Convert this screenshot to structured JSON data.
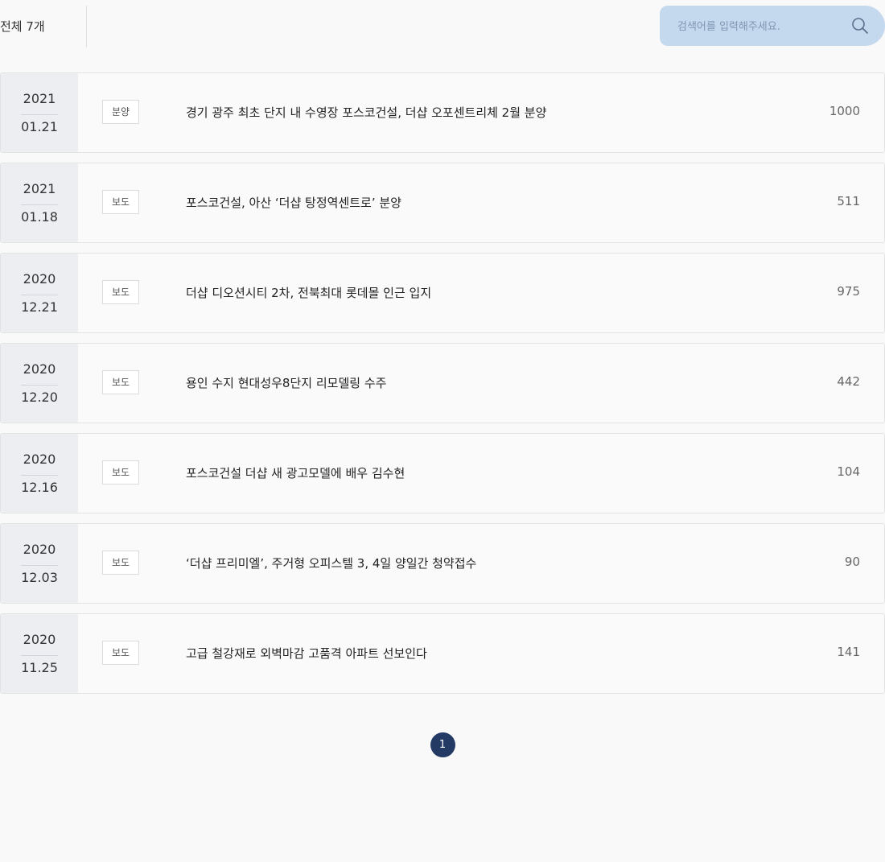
{
  "header": {
    "total_label": "전체 7개",
    "search": {
      "placeholder": "검색어를 입력해주세요.",
      "value": ""
    }
  },
  "posts": [
    {
      "year": "2021",
      "date": "01.21",
      "tag": "분양",
      "title": "경기 광주 최초 단지 내 수영장 포스코건설, 더샵 오포센트리체 2월 분양",
      "views": "1000"
    },
    {
      "year": "2021",
      "date": "01.18",
      "tag": "보도",
      "title": "포스코건설, 아산 ‘더샵 탕정역센트로’ 분양",
      "views": "511"
    },
    {
      "year": "2020",
      "date": "12.21",
      "tag": "보도",
      "title": "더샵 디오션시티 2차, 전북최대 롯데몰 인근 입지",
      "views": "975"
    },
    {
      "year": "2020",
      "date": "12.20",
      "tag": "보도",
      "title": "용인 수지 현대성우8단지 리모델링 수주",
      "views": "442"
    },
    {
      "year": "2020",
      "date": "12.16",
      "tag": "보도",
      "title": "포스코건설 더샵 새 광고모델에 배우 김수현",
      "views": "104"
    },
    {
      "year": "2020",
      "date": "12.03",
      "tag": "보도",
      "title": "‘더샵 프리미엘’, 주거형 오피스텔 3, 4일 양일간 청약접수",
      "views": "90"
    },
    {
      "year": "2020",
      "date": "11.25",
      "tag": "보도",
      "title": "고급 철강재로 외벽마감 고품격 아파트 선보인다",
      "views": "141"
    }
  ],
  "pagination": {
    "current": "1"
  },
  "colors": {
    "search_bg": "#c5d9ee",
    "date_bg": "#eceef2",
    "page_active": "#233a64"
  }
}
